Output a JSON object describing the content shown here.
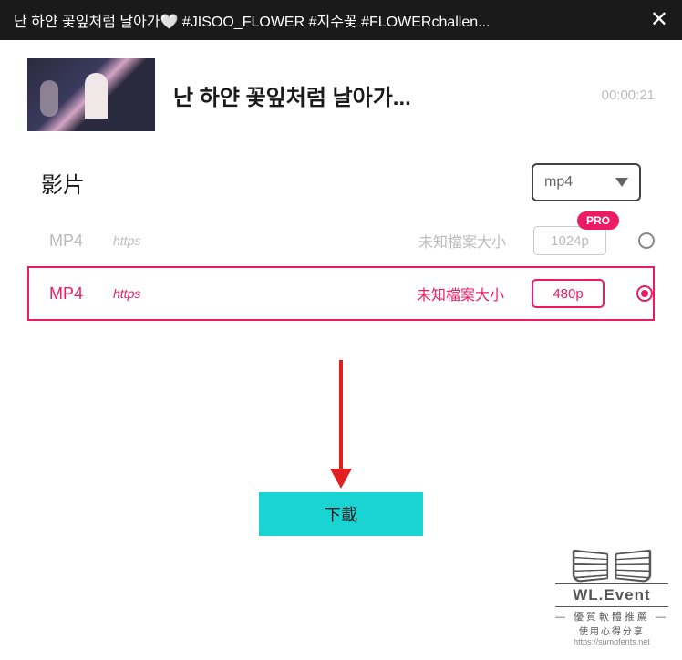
{
  "titleBar": {
    "title": "난 하얀 꽃잎처럼 날아가🤍 #JISOO_FLOWER #지수꽃 #FLOWERchallen..."
  },
  "videoInfo": {
    "title": "난 하얀 꽃잎처럼 날아가...",
    "duration": "00:00:21"
  },
  "formatSection": {
    "label": "影片",
    "selectedFormat": "mp4"
  },
  "options": [
    {
      "format": "MP4",
      "protocol": "https",
      "size": "未知檔案大小",
      "quality": "1024p",
      "proBadge": "PRO",
      "selected": false
    },
    {
      "format": "MP4",
      "protocol": "https",
      "size": "未知檔案大小",
      "quality": "480p",
      "selected": true
    }
  ],
  "downloadButton": "下載",
  "watermark": {
    "title": "WL.Event",
    "line1": "優質軟體推薦",
    "line2": "使用心得分享",
    "url": "https://sumofents.net"
  }
}
